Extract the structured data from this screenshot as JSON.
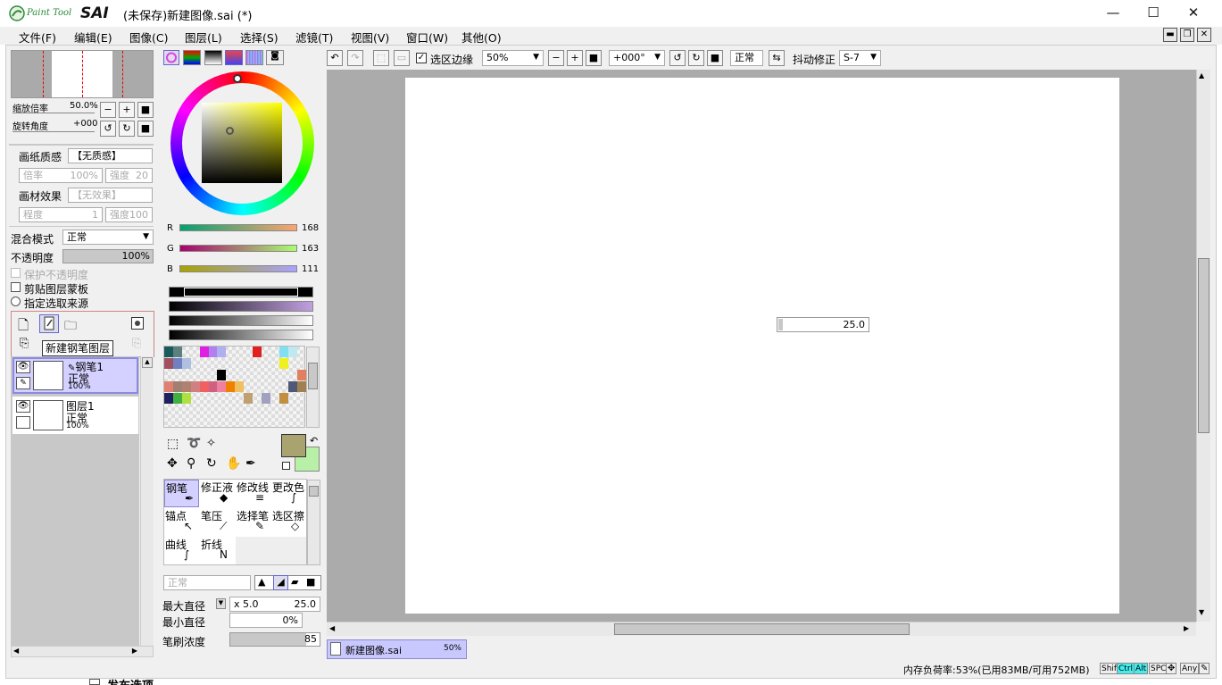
{
  "app": {
    "logo_small": "Paint Tool",
    "logo_big": "SAI",
    "title": "(未保存)新建图像.sai (*)"
  },
  "window_controls": {
    "minimize": "—",
    "maximize": "☐",
    "close": "✕"
  },
  "menu": [
    "文件(F)",
    "编辑(E)",
    "图像(C)",
    "图层(L)",
    "选择(S)",
    "滤镜(T)",
    "视图(V)",
    "窗口(W)",
    "其他(O)"
  ],
  "navigator": {
    "zoom_label": "缩放倍率",
    "zoom_value": "50.0%",
    "rotate_label": "旋转角度",
    "rotate_value": "+000"
  },
  "paper": {
    "texture_label": "画纸质感",
    "texture_value": "【无质感】",
    "scale_label": "倍率",
    "scale_value": "100%",
    "strength_label": "强度",
    "strength_value": "20",
    "effect_label": "画材效果",
    "effect_value": "【无效果】",
    "degree_label": "程度",
    "degree_value": "1",
    "strength2_value": "100"
  },
  "layer_props": {
    "blend_label": "混合模式",
    "blend_value": "正常",
    "opacity_label": "不透明度",
    "opacity_value": "100%",
    "opacity_level": 1.0,
    "protect": "保护不透明度",
    "clip": "剪贴图层蒙板",
    "source": "指定选取来源"
  },
  "tooltip": "新建钢笔图层",
  "layers": [
    {
      "name": "钢笔1",
      "mode": "正常",
      "opacity": "100%",
      "selected": true
    },
    {
      "name": "图层1",
      "mode": "正常",
      "opacity": "100%",
      "selected": false
    }
  ],
  "color": {
    "r_label": "R",
    "r_value": "168",
    "g_label": "G",
    "g_value": "163",
    "b_label": "B",
    "b_value": "111",
    "current": "#a8a36f",
    "secondary": "#b8f0a8",
    "swatches": [
      "#1a5a5a",
      "#5a8080",
      "",
      "",
      "#e020e0",
      "#b080f0",
      "#b0b0f0",
      "",
      "",
      "",
      "#e02020",
      "",
      "",
      "#80e0f0",
      "#c0e8f0",
      "",
      "#a05060",
      "#7080c0",
      "#b0c0e0",
      "",
      "",
      "",
      "",
      "",
      "",
      "",
      "",
      "",
      "",
      "#f0f020",
      "",
      "",
      "",
      "",
      "",
      "",
      "",
      "",
      "#000000",
      "",
      "",
      "",
      "",
      "",
      "",
      "",
      "",
      "#e08060",
      "#e08070",
      "#a08070",
      "#b08070",
      "#d08080",
      "#f06060",
      "#d06080",
      "#f080a0",
      "#f08000",
      "#f0c060",
      "",
      "",
      "",
      "",
      "",
      "#505878",
      "#a08050",
      "#202060",
      "#40b040",
      "#b0e040",
      "",
      "",
      "",
      "",
      "",
      "",
      "#c0a070",
      "",
      "#a0a0c0",
      "",
      "#c09040",
      ""
    ]
  },
  "tools": {
    "pen": "钢笔",
    "correct": "修正液",
    "fix_line": "修改线",
    "recolor": "更改色",
    "anchor": "锚点",
    "pressure": "笔压",
    "sel_pen": "选择笔",
    "sel_erase": "选区擦",
    "curve": "曲线",
    "polyline": "折线"
  },
  "brush": {
    "mode": "正常",
    "max_label": "最大直径",
    "max_mult": "x 5.0",
    "max_value": "25.0",
    "min_label": "最小直径",
    "min_value": "0%",
    "density_label": "笔刷浓度",
    "density_value": "85",
    "density_level": 0.85
  },
  "toolbar": {
    "sel_edge": "选区边缘",
    "zoom": "50%",
    "rotate": "+000°",
    "blend": "正常",
    "stabilizer_label": "抖动修正",
    "stabilizer_value": "S-7"
  },
  "canvas": {
    "size_readout": "25.0"
  },
  "doc_tab": {
    "name": "新建图像.sai",
    "zoom": "50%"
  },
  "status": {
    "memory": "内存负荷率:53%(已用83MB/可用752MB)",
    "keys": [
      "Shift",
      "Ctrl",
      "Alt",
      "SPC",
      "Any"
    ]
  },
  "bottom_hint": "发布选项"
}
